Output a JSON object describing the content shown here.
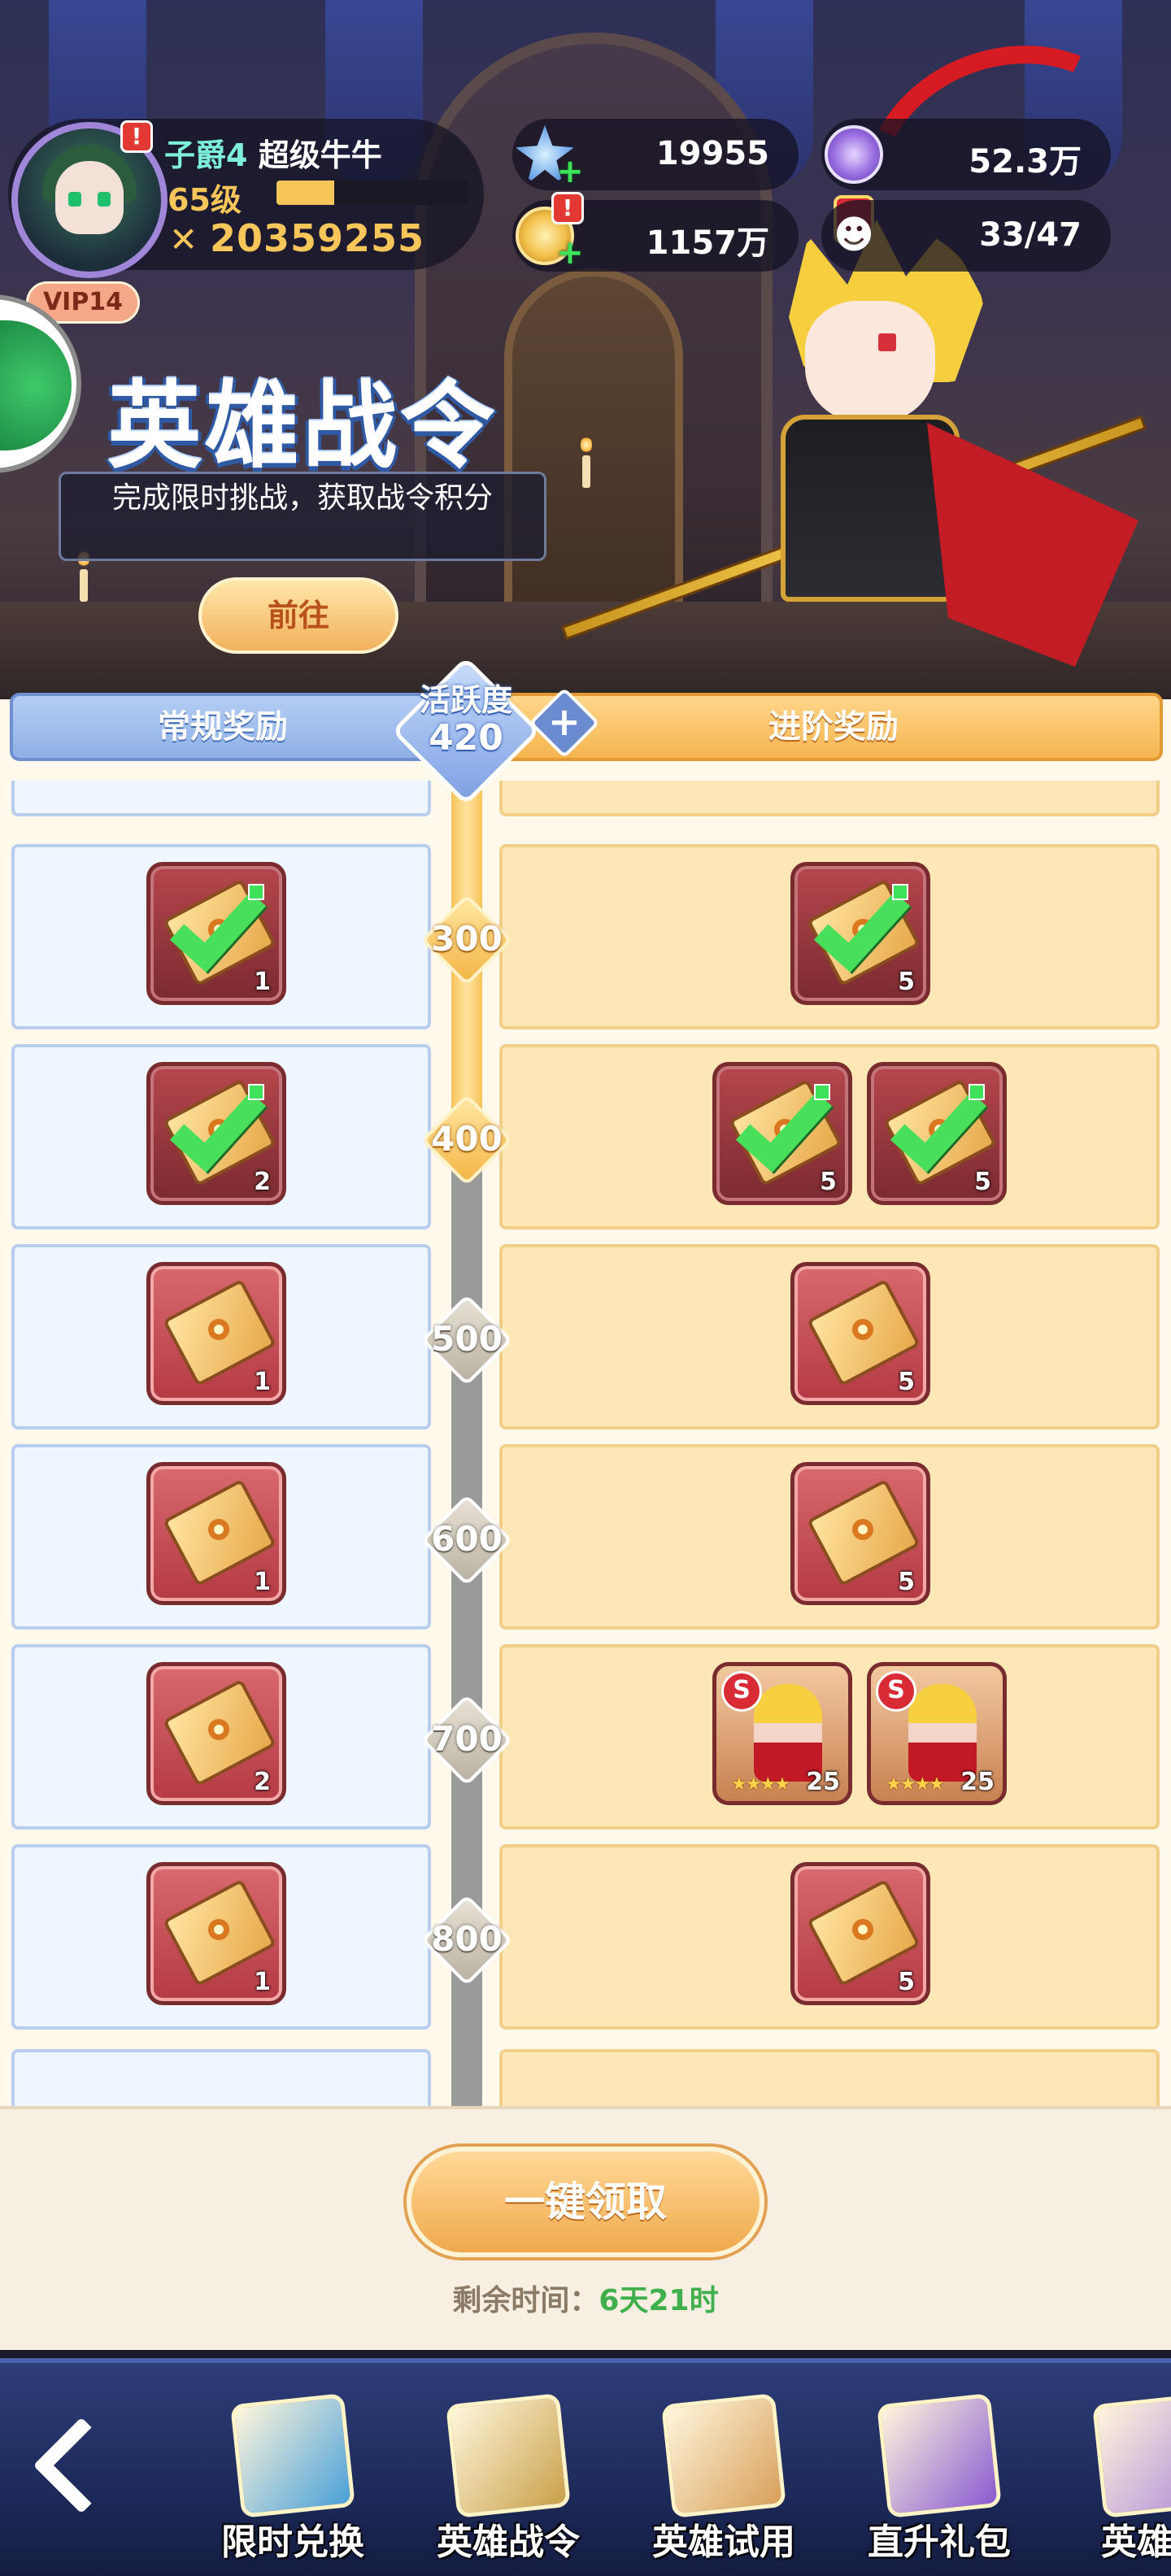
{
  "player": {
    "rank_title": "子爵4",
    "name": "超级牛牛",
    "level": "65级",
    "exp_fraction": 0.3,
    "power_icon": "crossed-swords-icon",
    "power": "20359255",
    "vip": "VIP14",
    "alert": "!"
  },
  "currencies": {
    "stars": {
      "value": "19955",
      "icon": "star-crystal-icon"
    },
    "purple_coin": {
      "value": "52.3万",
      "icon": "purple-coin-icon"
    },
    "gold": {
      "value": "1157万",
      "icon": "gold-coin-icon",
      "alert": "!"
    },
    "friends": {
      "value": "33/47",
      "icon": "friends-icon"
    }
  },
  "banner": {
    "title": "英雄战令",
    "description": "完成限时挑战，获取战令积分",
    "go_label": "前往"
  },
  "track": {
    "normal_tab": "常规奖励",
    "advanced_tab": "进阶奖励",
    "activity_label": "活跃度",
    "activity_value": "420",
    "unlock_icon": "plus-icon",
    "rows": [
      {
        "milestone": "300",
        "active": true,
        "normal": [
          {
            "kind": "ticket",
            "qty": "1",
            "claimed": true
          }
        ],
        "advanced": [
          {
            "kind": "ticket",
            "qty": "5",
            "claimed": true
          }
        ]
      },
      {
        "milestone": "400",
        "active": true,
        "normal": [
          {
            "kind": "ticket",
            "qty": "2",
            "claimed": true
          }
        ],
        "advanced": [
          {
            "kind": "ticket",
            "qty": "5",
            "claimed": true
          },
          {
            "kind": "ticket",
            "qty": "5",
            "claimed": true
          }
        ]
      },
      {
        "milestone": "500",
        "active": false,
        "normal": [
          {
            "kind": "ticket",
            "qty": "1",
            "claimed": false
          }
        ],
        "advanced": [
          {
            "kind": "ticket",
            "qty": "5",
            "claimed": false
          }
        ]
      },
      {
        "milestone": "600",
        "active": false,
        "normal": [
          {
            "kind": "ticket",
            "qty": "1",
            "claimed": false
          }
        ],
        "advanced": [
          {
            "kind": "ticket",
            "qty": "5",
            "claimed": false
          }
        ]
      },
      {
        "milestone": "700",
        "active": false,
        "normal": [
          {
            "kind": "ticket",
            "qty": "2",
            "claimed": false
          }
        ],
        "advanced": [
          {
            "kind": "hero",
            "qty": "25",
            "rank": "S",
            "stars": "★★★★"
          },
          {
            "kind": "hero",
            "qty": "25",
            "rank": "S",
            "stars": "★★★★"
          }
        ]
      },
      {
        "milestone": "800",
        "active": false,
        "normal": [
          {
            "kind": "ticket",
            "qty": "1",
            "claimed": false
          }
        ],
        "advanced": [
          {
            "kind": "ticket",
            "qty": "5",
            "claimed": false
          }
        ]
      }
    ]
  },
  "footer": {
    "claim_all_label": "一键领取",
    "time_label": "剩余时间：",
    "time_value": "6天21时"
  },
  "nav": [
    {
      "label": "限时兑换",
      "icon": "gift-box-icon",
      "color": "#4aa0d8"
    },
    {
      "label": "英雄战令",
      "icon": "winged-emblem-icon",
      "color": "#c9a14a"
    },
    {
      "label": "英雄试用",
      "icon": "hero-portrait-icon",
      "color": "#d8a05a"
    },
    {
      "label": "直升礼包",
      "icon": "purple-gift-icon",
      "color": "#8a5ad1"
    },
    {
      "label": "英雄证",
      "icon": "hero-card-icon",
      "color": "#b08ad8"
    }
  ]
}
